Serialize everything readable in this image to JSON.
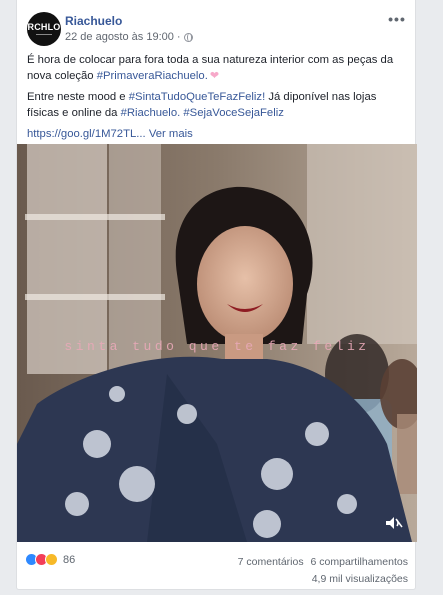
{
  "post": {
    "avatar_text": "RCHLO",
    "page_name": "Riachuelo",
    "timestamp": "22 de agosto às 19:00",
    "paragraph1": "É hora de colocar para fora toda a sua natureza interior com as peças da nova coleção",
    "hashtag1": "#PrimaveraRiachuelo.",
    "paragraph2_a": "Entre neste mood e",
    "hashtag2": "#SintaTudoQueTeFazFeliz!",
    "paragraph2_b": "Já diponível nas lojas físicas e online da",
    "hashtag3": "#Riachuelo.",
    "hashtag4": "#SejaVoceSejaFeliz",
    "link": "https://goo.gl/1M72TL...",
    "see_more": "Ver mais",
    "video_caption": "sinta tudo que te faz feliz",
    "reaction_count": "86",
    "comments": "7 comentários",
    "shares": "6 compartilhamentos",
    "views": "4,9 mil visualizações"
  },
  "icons": [
    "globe-icon",
    "more-options-icon",
    "heart-emoji-icon",
    "volume-icon",
    "like-reaction-icon",
    "love-reaction-icon",
    "wow-reaction-icon"
  ],
  "colors": {
    "link": "#385898",
    "background": "#e9ebee",
    "like": "#2e89ff",
    "love": "#f33e58",
    "wow": "#f7b928"
  }
}
